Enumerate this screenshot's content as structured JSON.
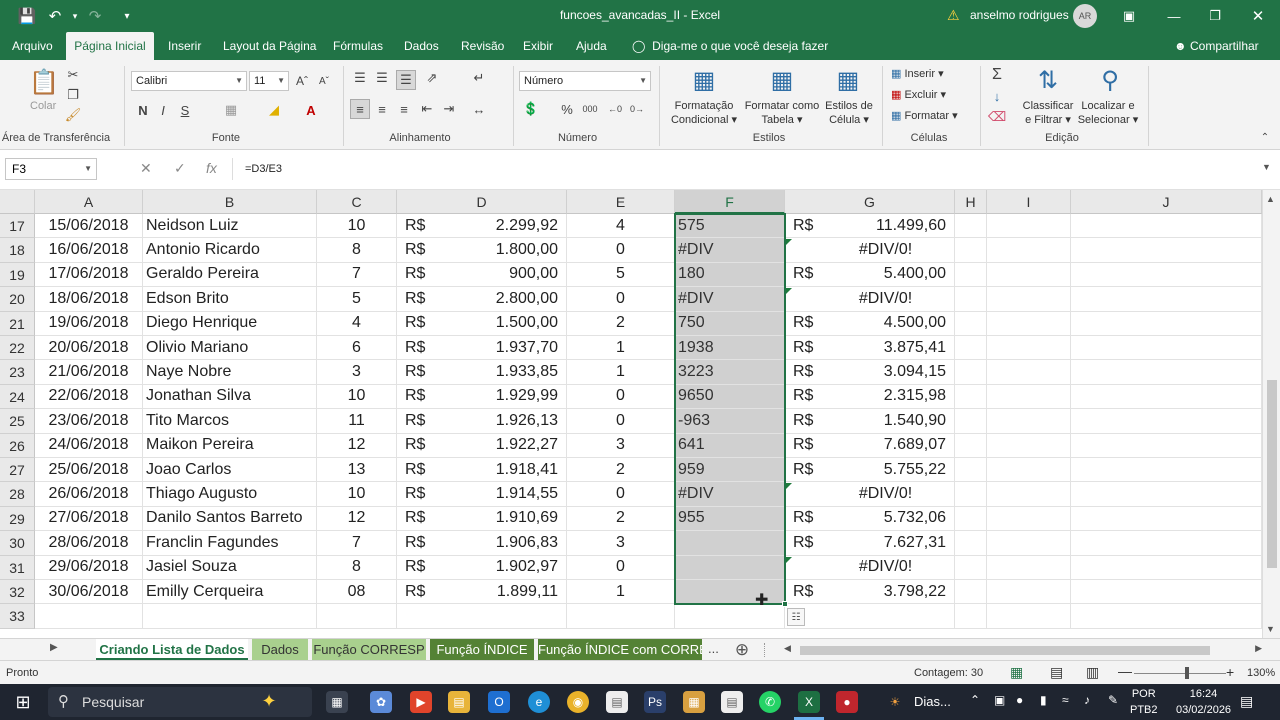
{
  "window": {
    "title": "funcoes_avancadas_II  -  Excel",
    "user": "anselmo rodrigues",
    "avatar": "AR"
  },
  "menu_tabs": [
    "Arquivo",
    "Página Inicial",
    "Inserir",
    "Layout da Página",
    "Fórmulas",
    "Dados",
    "Revisão",
    "Exibir",
    "Ajuda"
  ],
  "active_tab": "Página Inicial",
  "tell_me": "Diga-me o que você deseja fazer",
  "share": "Compartilhar",
  "ribbon": {
    "clipboard": {
      "label": "Área de Transferência",
      "paste": "Colar"
    },
    "font": {
      "label": "Fonte",
      "name": "Calibri",
      "size": "11",
      "bold": "N",
      "italic": "I",
      "underline": "S"
    },
    "alignment": {
      "label": "Alinhamento"
    },
    "number": {
      "label": "Número",
      "format": "Número"
    },
    "styles": {
      "label": "Estilos",
      "cond": [
        "Formatação",
        "Condicional"
      ],
      "table": [
        "Formatar como",
        "Tabela"
      ],
      "cell": [
        "Estilos de",
        "Célula"
      ]
    },
    "cells": {
      "label": "Células",
      "insert": "Inserir",
      "delete": "Excluir",
      "format": "Formatar"
    },
    "editing": {
      "label": "Edição",
      "sort": [
        "Classificar",
        "e Filtrar"
      ],
      "find": [
        "Localizar e",
        "Selecionar"
      ]
    }
  },
  "formula_bar": {
    "name_box": "F3",
    "fx": "fx",
    "formula": "=D3/E3"
  },
  "columns": [
    "A",
    "B",
    "C",
    "D",
    "E",
    "F",
    "G",
    "H",
    "I",
    "J"
  ],
  "rows": [
    {
      "n": "17",
      "a": "15/06/2018",
      "b": "Neidson Luiz",
      "c": "10",
      "cur": "R$",
      "d": "2.299,92",
      "e": "4",
      "f": "575",
      "gc": "R$",
      "g": "11.499,60"
    },
    {
      "n": "18",
      "a": "16/06/2018",
      "b": "Antonio Ricardo",
      "c": "8",
      "cur": "R$",
      "d": "1.800,00",
      "e": "0",
      "f": "#DIV",
      "gc": "",
      "g": "#DIV/0!"
    },
    {
      "n": "19",
      "a": "17/06/2018",
      "b": "Geraldo Pereira",
      "c": "7",
      "cur": "R$",
      "d": "900,00",
      "e": "5",
      "f": "180",
      "gc": "R$",
      "g": "5.400,00"
    },
    {
      "n": "20",
      "a": "18/06/2018",
      "b": "Edson Brito",
      "c": "5",
      "cur": "R$",
      "d": "2.800,00",
      "e": "0",
      "f": "#DIV",
      "gc": "",
      "g": "#DIV/0!"
    },
    {
      "n": "21",
      "a": "19/06/2018",
      "b": "Diego Henrique",
      "c": "4",
      "cur": "R$",
      "d": "1.500,00",
      "e": "2",
      "f": "750",
      "gc": "R$",
      "g": "4.500,00"
    },
    {
      "n": "22",
      "a": "20/06/2018",
      "b": "Olivio Mariano",
      "c": "6",
      "cur": "R$",
      "d": "1.937,70",
      "e": "1",
      "f": "1938",
      "gc": "R$",
      "g": "3.875,41"
    },
    {
      "n": "23",
      "a": "21/06/2018",
      "b": "Naye Nobre",
      "c": "3",
      "cur": "R$",
      "d": "1.933,85",
      "e": "1",
      "f": "3223",
      "gc": "R$",
      "g": "3.094,15"
    },
    {
      "n": "24",
      "a": "22/06/2018",
      "b": "Jonathan Silva",
      "c": "10",
      "cur": "R$",
      "d": "1.929,99",
      "e": "0",
      "f": "9650",
      "gc": "R$",
      "g": "2.315,98"
    },
    {
      "n": "25",
      "a": "23/06/2018",
      "b": "Tito Marcos",
      "c": "11",
      "cur": "R$",
      "d": "1.926,13",
      "e": "0",
      "f": "-963",
      "gc": "R$",
      "g": "1.540,90"
    },
    {
      "n": "26",
      "a": "24/06/2018",
      "b": "Maikon Pereira",
      "c": "12",
      "cur": "R$",
      "d": "1.922,27",
      "e": "3",
      "f": "641",
      "gc": "R$",
      "g": "7.689,07"
    },
    {
      "n": "27",
      "a": "25/06/2018",
      "b": "Joao Carlos",
      "c": "13",
      "cur": "R$",
      "d": "1.918,41",
      "e": "2",
      "f": "959",
      "gc": "R$",
      "g": "5.755,22"
    },
    {
      "n": "28",
      "a": "26/06/2018",
      "b": "Thiago Augusto",
      "c": "10",
      "cur": "R$",
      "d": "1.914,55",
      "e": "0",
      "f": "#DIV",
      "gc": "",
      "g": "#DIV/0!"
    },
    {
      "n": "29",
      "a": "27/06/2018",
      "b": "Danilo Santos Barreto",
      "c": "12",
      "cur": "R$",
      "d": "1.910,69",
      "e": "2",
      "f": "955",
      "gc": "R$",
      "g": "5.732,06"
    },
    {
      "n": "30",
      "a": "28/06/2018",
      "b": "Franclin Fagundes",
      "c": "7",
      "cur": "R$",
      "d": "1.906,83",
      "e": "3",
      "f": "",
      "gc": "R$",
      "g": "7.627,31"
    },
    {
      "n": "31",
      "a": "29/06/2018",
      "b": "Jasiel Souza",
      "c": "8",
      "cur": "R$",
      "d": "1.902,97",
      "e": "0",
      "f": "",
      "gc": "",
      "g": "#DIV/0!"
    },
    {
      "n": "32",
      "a": "30/06/2018",
      "b": "Emilly Cerqueira",
      "c": "08",
      "cur": "R$",
      "d": "1.899,11",
      "e": "1",
      "f": "",
      "gc": "R$",
      "g": "3.798,22"
    },
    {
      "n": "33",
      "a": "",
      "b": "",
      "c": "",
      "cur": "",
      "d": "",
      "e": "",
      "f": "",
      "gc": "",
      "g": ""
    }
  ],
  "sheet_tabs": [
    "Criando Lista de Dados",
    "Dados",
    "Função CORRESP",
    "Função ÍNDICE",
    "Função ÍNDICE com CORRE"
  ],
  "active_sheet": "Criando Lista de Dados",
  "sheet_more": "...",
  "status": {
    "mode": "Pronto",
    "count": "Contagem: 30",
    "zoom": "130%",
    "zoom_level_percent": 130
  },
  "taskbar": {
    "search": "Pesquisar",
    "news": "Dias...",
    "lang": [
      "POR",
      "PTB2"
    ],
    "time": "16:24",
    "date": "03/02/2026"
  },
  "colors": {
    "excel_green": "#217346",
    "ribbon_bg": "#f3f3f3",
    "selection_fill": "#d0d0d0",
    "tab_light": "#a9d08e",
    "tab_dark": "#548235",
    "taskbar": "#1f2530"
  }
}
